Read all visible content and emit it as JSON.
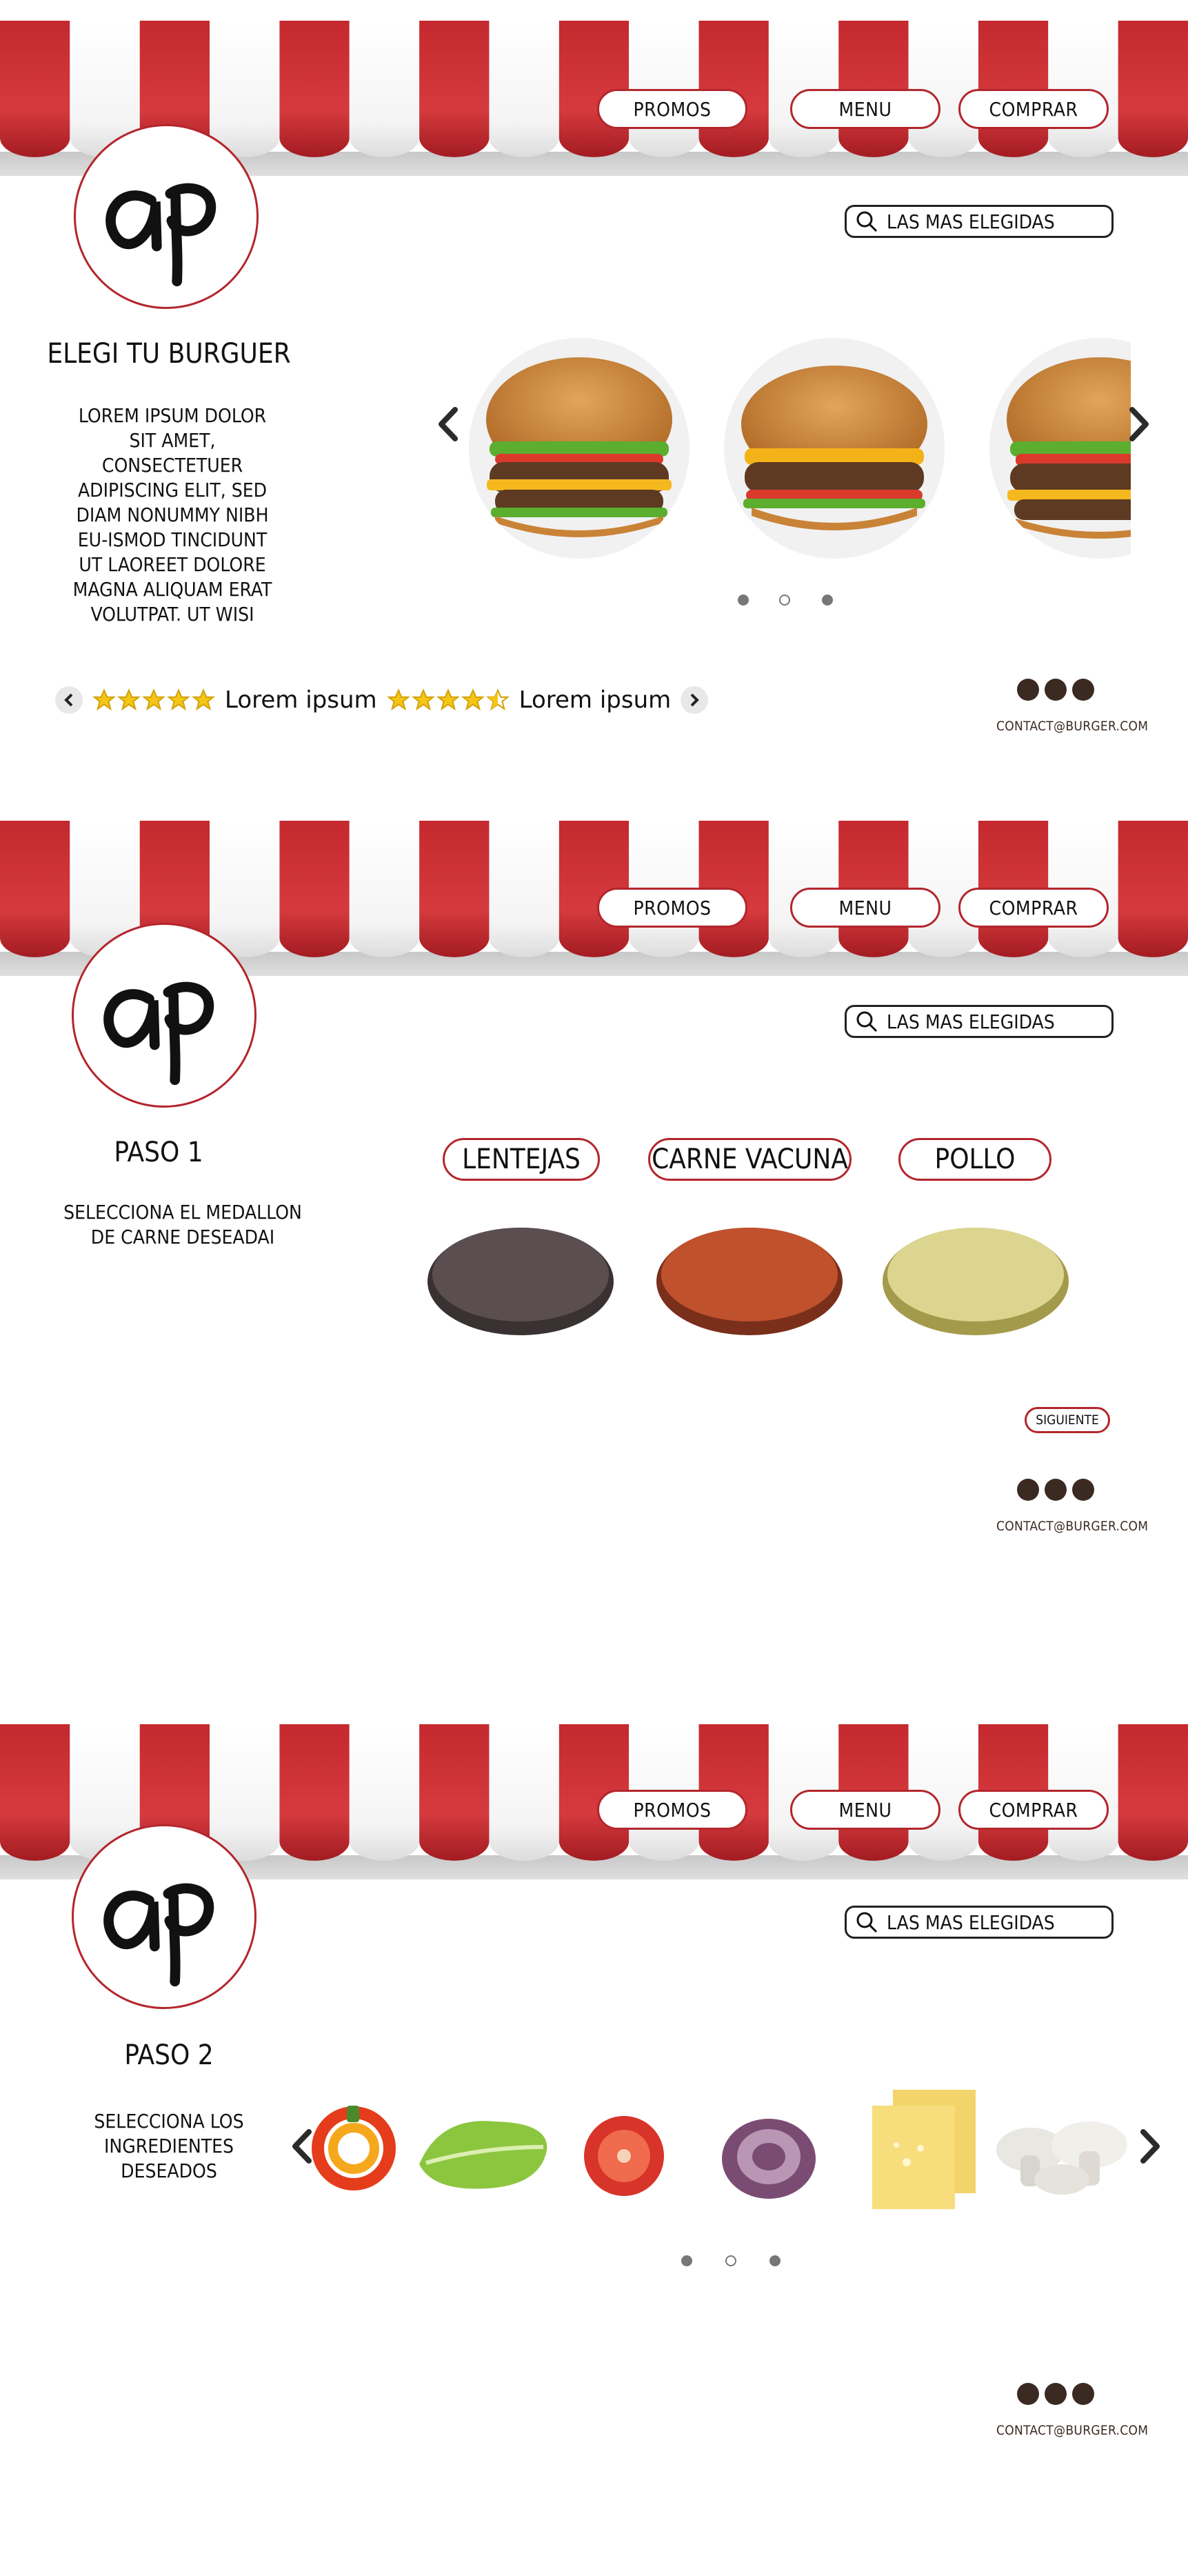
{
  "brand": {
    "logo_text": "ap"
  },
  "nav": {
    "promos": "PROMOS",
    "menu": "MENU",
    "comprar": "COMPRAR"
  },
  "search": {
    "label": "LAS MAS ELEGIDAS"
  },
  "footer": {
    "contact": "CONTACT@BURGER.COM",
    "social_icons": [
      "instagram-icon",
      "facebook-icon",
      "whatsapp-icon"
    ]
  },
  "colors": {
    "accent": "#b3262c",
    "stripe_red": "#c62a2f",
    "dark": "#3b2a22"
  },
  "screen1": {
    "title": "ELEGI TU BURGUER",
    "description": "LOREM IPSUM DOLOR SIT AMET, CONSECTETUER ADIPISCING ELIT, SED DIAM NONUMMY NIBH EU-ISMOD TINCIDUNT UT LAOREET DOLORE MAGNA ALIQUAM ERAT VOLUTPAT. UT WISI",
    "reviews": [
      {
        "rating": 5,
        "text": "Lorem ipsum"
      },
      {
        "rating": 4.5,
        "text": "Lorem ipsum"
      }
    ],
    "carousel_dots": 3
  },
  "screen2": {
    "title": "PASO 1",
    "description": "SELECCIONA EL MEDALLON DE CARNE DESEADAI",
    "options": [
      "LENTEJAS",
      "CARNE VACUNA",
      "POLLO"
    ],
    "next_button": "SIGUIENTE"
  },
  "screen3": {
    "title": "PASO 2",
    "description": "SELECCIONA LOS INGREDIENTES DESEADOS",
    "ingredients": [
      "pepper",
      "lettuce",
      "tomato",
      "onion",
      "cheese",
      "mushrooms"
    ],
    "carousel_dots": 3
  }
}
